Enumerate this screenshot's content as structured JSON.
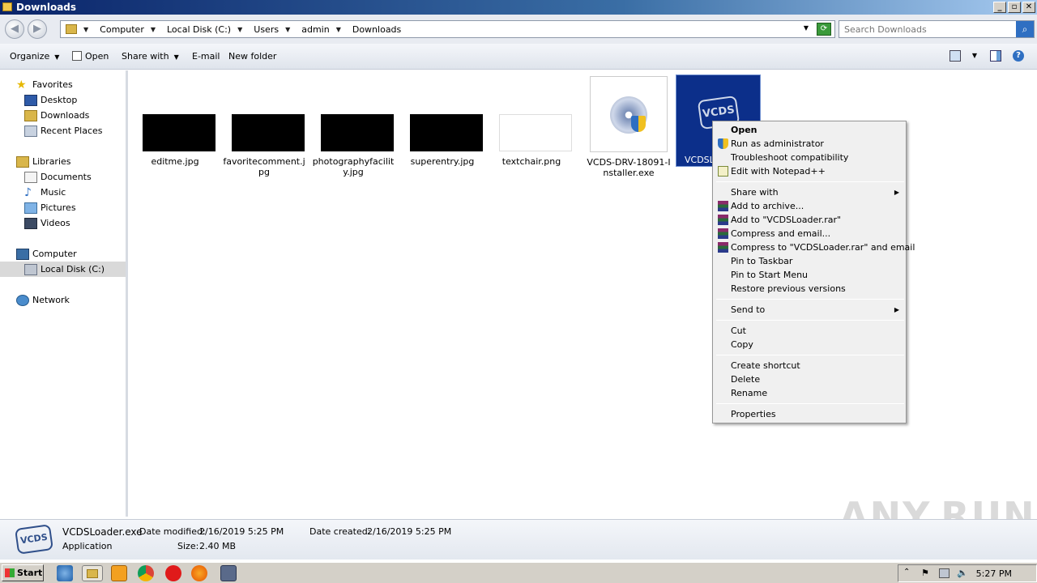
{
  "window": {
    "title": "Downloads",
    "buttons": [
      "_",
      "▫",
      "✕"
    ]
  },
  "address": {
    "crumbs": [
      "Computer",
      "Local Disk (C:)",
      "Users",
      "admin",
      "Downloads"
    ],
    "search_placeholder": "Search Downloads"
  },
  "toolbar": {
    "organize": "Organize",
    "open": "Open",
    "share_with": "Share with",
    "email": "E-mail",
    "new_folder": "New folder"
  },
  "nav": {
    "favorites": "Favorites",
    "desktop": "Desktop",
    "downloads": "Downloads",
    "recent_places": "Recent Places",
    "libraries": "Libraries",
    "documents": "Documents",
    "music": "Music",
    "pictures": "Pictures",
    "videos": "Videos",
    "computer": "Computer",
    "local_disk": "Local Disk (C:)",
    "network": "Network"
  },
  "files": [
    {
      "name": "editme.jpg"
    },
    {
      "name": "favoritecomment.jpg"
    },
    {
      "name": "photographyfacility.jpg"
    },
    {
      "name": "superentry.jpg"
    },
    {
      "name": "textchair.png"
    },
    {
      "name": "VCDS-DRV-18091-Installer.exe"
    },
    {
      "name": "VCDSLo"
    }
  ],
  "context_menu": {
    "items": [
      "Open",
      "Run as administrator",
      "Troubleshoot compatibility",
      "Edit with Notepad++",
      "Share with",
      "Add to archive...",
      "Add to \"VCDSLoader.rar\"",
      "Compress and email...",
      "Compress to \"VCDSLoader.rar\" and email",
      "Pin to Taskbar",
      "Pin to Start Menu",
      "Restore previous versions",
      "Send to",
      "Cut",
      "Copy",
      "Create shortcut",
      "Delete",
      "Rename",
      "Properties"
    ]
  },
  "details": {
    "filename": "VCDSLoader.exe",
    "type": "Application",
    "date_modified_label": "Date modified:",
    "date_modified": "2/16/2019 5:25 PM",
    "size_label": "Size:",
    "size": "2.40 MB",
    "date_created_label": "Date created:",
    "date_created": "2/16/2019 5:25 PM",
    "icon_text": "VCDS"
  },
  "taskbar": {
    "start": "Start",
    "clock": "5:27 PM"
  },
  "watermark": "ANY.RUN",
  "colors": {
    "selection": "#0c2f8a",
    "titlebar": "#0a246a"
  }
}
